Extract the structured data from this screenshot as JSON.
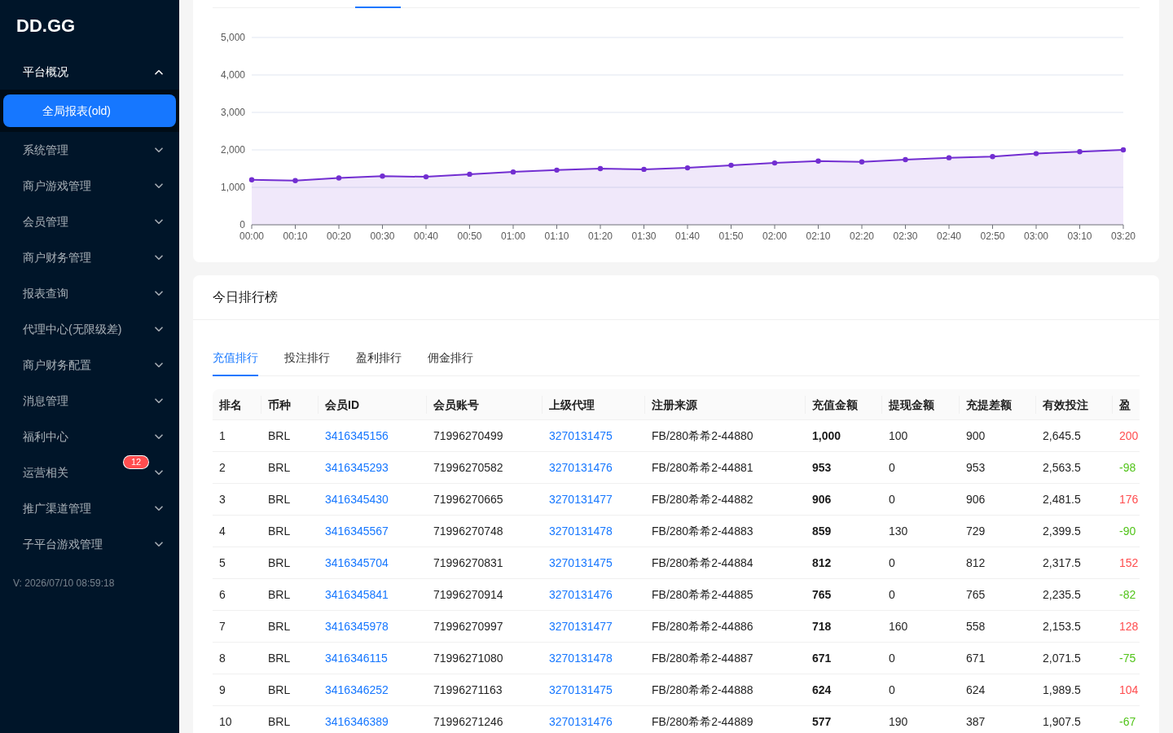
{
  "sidebar": {
    "logo": "DD.GG",
    "items": [
      {
        "label": "平台概况",
        "expanded": true,
        "children": [
          {
            "label": "全局报表(old)",
            "selected": true
          }
        ]
      },
      {
        "label": "系统管理",
        "expanded": false
      },
      {
        "label": "商户游戏管理",
        "expanded": false
      },
      {
        "label": "会员管理",
        "expanded": false
      },
      {
        "label": "商户财务管理",
        "expanded": false
      },
      {
        "label": "报表查询",
        "expanded": false
      },
      {
        "label": "代理中心(无限级差)",
        "expanded": false
      },
      {
        "label": "商户财务配置",
        "expanded": false
      },
      {
        "label": "消息管理",
        "expanded": false
      },
      {
        "label": "福利中心",
        "expanded": false
      },
      {
        "label": "运营相关",
        "expanded": false,
        "badge": "12"
      },
      {
        "label": "推广渠道管理",
        "expanded": false
      },
      {
        "label": "子平台游戏管理",
        "expanded": false
      }
    ],
    "version": "V: 2026/07/10 08:59:18"
  },
  "chart_card": {
    "chart_data": {
      "type": "area",
      "categories": [
        "00:00",
        "00:10",
        "00:20",
        "00:30",
        "00:40",
        "00:50",
        "01:00",
        "01:10",
        "01:20",
        "01:30",
        "01:40",
        "01:50",
        "02:00",
        "02:10",
        "02:20",
        "02:30",
        "02:40",
        "02:50",
        "03:00",
        "03:10",
        "03:20"
      ],
      "series": [
        {
          "color": "#722ed1",
          "values": [
            1200,
            1180,
            1250,
            1300,
            1280,
            1350,
            1410,
            1460,
            1500,
            1480,
            1520,
            1590,
            1650,
            1700,
            1680,
            1740,
            1790,
            1820,
            1900,
            1950,
            2000
          ]
        }
      ],
      "ylim": [
        0,
        5000
      ],
      "yticks": [
        {
          "value": 0,
          "label": "0"
        },
        {
          "value": 1000,
          "label": "1,000"
        },
        {
          "value": 2000,
          "label": "2,000"
        },
        {
          "value": 3000,
          "label": "3,000"
        },
        {
          "value": 4000,
          "label": "4,000"
        },
        {
          "value": 5000,
          "label": "5,000"
        }
      ],
      "grid": true
    }
  },
  "ranking": {
    "title": "今日排行榜",
    "tabs": [
      {
        "label": "充值排行",
        "selected": true
      },
      {
        "label": "投注排行",
        "selected": false
      },
      {
        "label": "盈利排行",
        "selected": false
      },
      {
        "label": "佣金排行",
        "selected": false
      }
    ],
    "table": {
      "columns": [
        {
          "label": "排名",
          "kind": "text"
        },
        {
          "label": "币种",
          "kind": "text"
        },
        {
          "label": "会员ID",
          "kind": "link"
        },
        {
          "label": "会员账号",
          "kind": "text"
        },
        {
          "label": "上级代理",
          "kind": "link"
        },
        {
          "label": "注册来源",
          "kind": "text"
        },
        {
          "label": "充值金额",
          "kind": "strong"
        },
        {
          "label": "提现金额",
          "kind": "text"
        },
        {
          "label": "充提差额",
          "kind": "text"
        },
        {
          "label": "有效投注",
          "kind": "text"
        },
        {
          "label": "盈",
          "kind": "signed"
        }
      ],
      "rows": [
        {
          "cells": [
            "1",
            "BRL",
            "3416345156",
            "71996270499",
            "3270131475",
            "FB/280希希2-44880",
            "1,000",
            "100",
            "900",
            "2,645.5",
            "200"
          ],
          "color": "#ff4d4f"
        },
        {
          "cells": [
            "2",
            "BRL",
            "3416345293",
            "71996270582",
            "3270131476",
            "FB/280希希2-44881",
            "953",
            "0",
            "953",
            "2,563.5",
            "-98"
          ],
          "color": "#52c41a"
        },
        {
          "cells": [
            "3",
            "BRL",
            "3416345430",
            "71996270665",
            "3270131477",
            "FB/280希希2-44882",
            "906",
            "0",
            "906",
            "2,481.5",
            "176"
          ],
          "color": "#ff4d4f"
        },
        {
          "cells": [
            "4",
            "BRL",
            "3416345567",
            "71996270748",
            "3270131478",
            "FB/280希希2-44883",
            "859",
            "130",
            "729",
            "2,399.5",
            "-90"
          ],
          "color": "#52c41a"
        },
        {
          "cells": [
            "5",
            "BRL",
            "3416345704",
            "71996270831",
            "3270131475",
            "FB/280希希2-44884",
            "812",
            "0",
            "812",
            "2,317.5",
            "152"
          ],
          "color": "#ff4d4f"
        },
        {
          "cells": [
            "6",
            "BRL",
            "3416345841",
            "71996270914",
            "3270131476",
            "FB/280希希2-44885",
            "765",
            "0",
            "765",
            "2,235.5",
            "-82"
          ],
          "color": "#52c41a"
        },
        {
          "cells": [
            "7",
            "BRL",
            "3416345978",
            "71996270997",
            "3270131477",
            "FB/280希希2-44886",
            "718",
            "160",
            "558",
            "2,153.5",
            "128"
          ],
          "color": "#ff4d4f"
        },
        {
          "cells": [
            "8",
            "BRL",
            "3416346115",
            "71996271080",
            "3270131478",
            "FB/280希希2-44887",
            "671",
            "0",
            "671",
            "2,071.5",
            "-75"
          ],
          "color": "#52c41a"
        },
        {
          "cells": [
            "9",
            "BRL",
            "3416346252",
            "71996271163",
            "3270131475",
            "FB/280希希2-44888",
            "624",
            "0",
            "624",
            "1,989.5",
            "104"
          ],
          "color": "#ff4d4f"
        },
        {
          "cells": [
            "10",
            "BRL",
            "3416346389",
            "71996271246",
            "3270131476",
            "FB/280希希2-44889",
            "577",
            "190",
            "387",
            "1,907.5",
            "-67"
          ],
          "color": "#52c41a"
        }
      ]
    }
  }
}
